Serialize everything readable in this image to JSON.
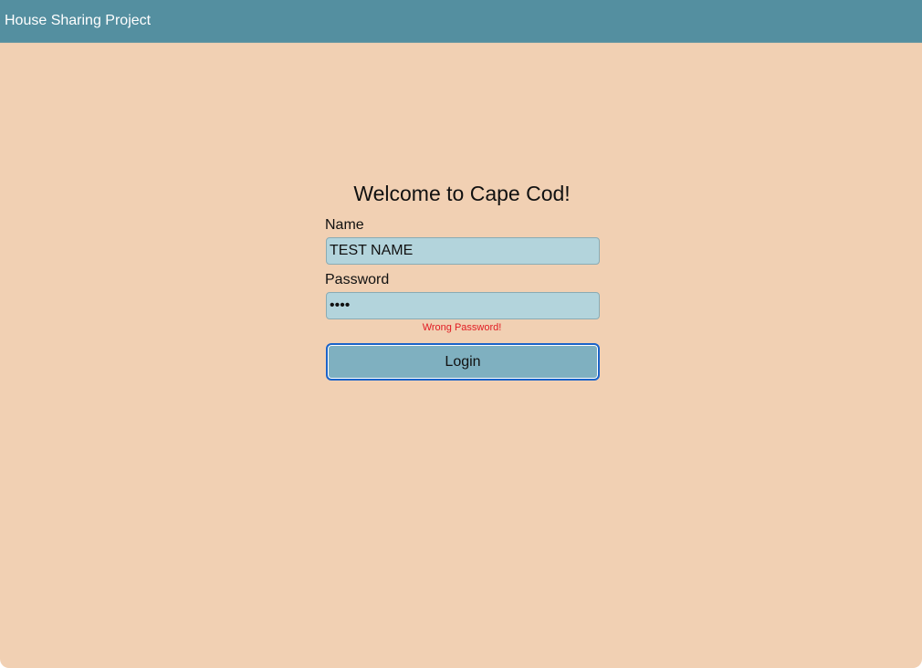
{
  "header": {
    "title": "House Sharing Project"
  },
  "login": {
    "welcome": "Welcome to Cape Cod!",
    "name_label": "Name",
    "name_value": "TEST NAME",
    "password_label": "Password",
    "password_value": "test",
    "error": "Wrong Password!",
    "button_label": "Login"
  },
  "colors": {
    "header_bg": "#548fa0",
    "page_bg": "#f1d0b3",
    "input_bg": "#b3d4dc",
    "button_bg": "#7fb0c0",
    "button_focus_border": "#1a63c9",
    "error_text": "#e11b22"
  }
}
